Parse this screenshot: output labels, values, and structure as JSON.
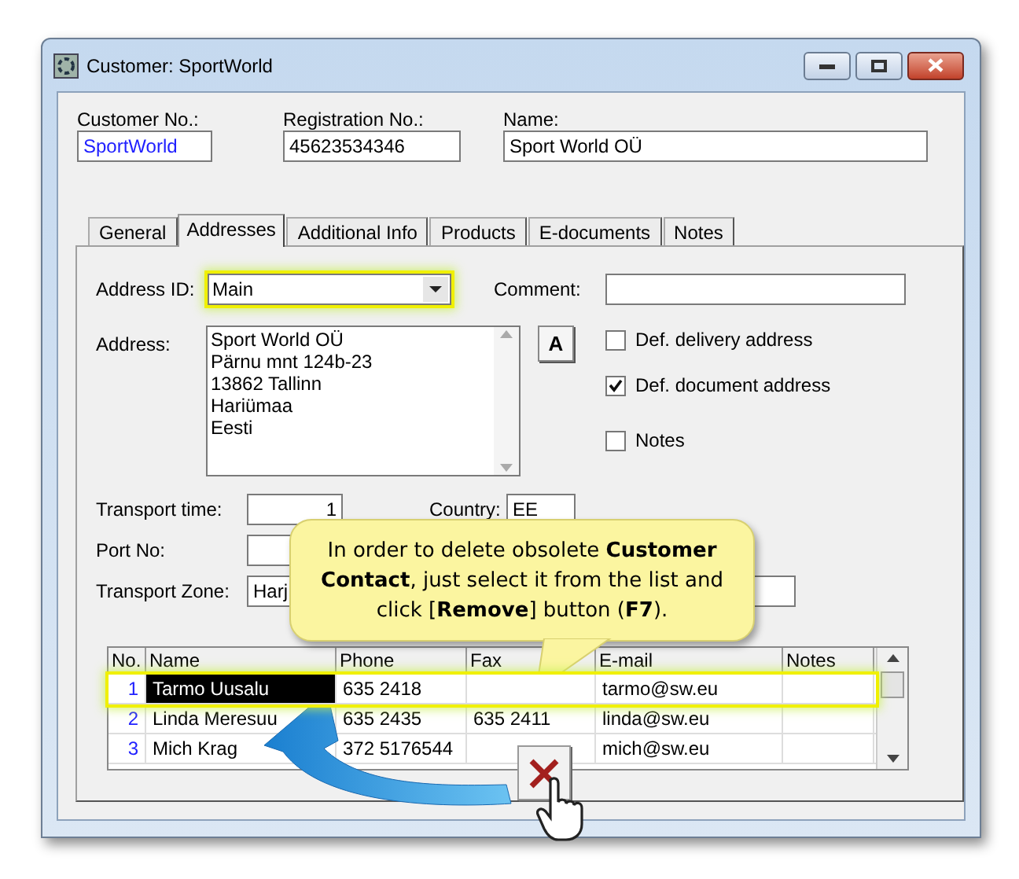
{
  "window": {
    "title": "Customer: SportWorld"
  },
  "header_fields": [
    {
      "label": "Customer No.:",
      "value": "SportWorld",
      "kind": "link"
    },
    {
      "label": "Registration No.:",
      "value": "45623534346",
      "kind": "text"
    },
    {
      "label": "Name:",
      "value": "Sport World OÜ",
      "kind": "text"
    }
  ],
  "tabs": [
    {
      "label": "General",
      "selected": false
    },
    {
      "label": "Addresses",
      "selected": true
    },
    {
      "label": "Additional Info",
      "selected": false
    },
    {
      "label": "Products",
      "selected": false
    },
    {
      "label": "E-documents",
      "selected": false
    },
    {
      "label": "Notes",
      "selected": false
    }
  ],
  "address_id": {
    "label": "Address ID:",
    "value": "Main",
    "highlighted": true
  },
  "comment": {
    "label": "Comment:"
  },
  "address": {
    "label": "Address:",
    "value": "Sport World OÜ\nPärnu mnt 124b-23\n13862 Tallinn\nHariümaa\nEesti"
  },
  "font_button": "A",
  "checkboxes": [
    {
      "label": "Def. delivery address",
      "checked": false
    },
    {
      "label": "Def. document address",
      "checked": true
    },
    {
      "label": "Notes",
      "checked": false
    }
  ],
  "transport_time": {
    "label": "Transport time:",
    "value": "1"
  },
  "country": {
    "label": "Country:",
    "value": "EE"
  },
  "port_no": {
    "label": "Port No:"
  },
  "transport_zone": {
    "label": "Transport Zone:",
    "value": "Harj"
  },
  "contacts": {
    "columns": [
      "No.",
      "Name",
      "Phone",
      "Fax",
      "E-mail",
      "Notes"
    ],
    "rows": [
      {
        "no": "1",
        "name": "Tarmo Uusalu",
        "phone": "635 2418",
        "email": "tarmo@sw.eu",
        "selected": true
      },
      {
        "no": "2",
        "name": "Linda Meresuu",
        "phone": "635 2435",
        "fax": "635 2411",
        "email": "linda@sw.eu",
        "selected": false
      },
      {
        "no": "3",
        "name": "Mich Krag",
        "phone": "372 5176544",
        "email": "mich@sw.eu",
        "selected": false
      }
    ]
  },
  "callout": {
    "text": "In order to delete obsolete **Customer Contact**, just select it from the list and click [**Remove**] button (**F7**)."
  }
}
